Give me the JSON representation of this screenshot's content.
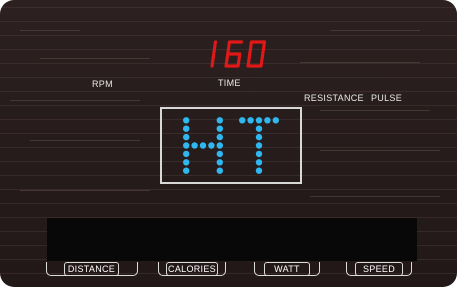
{
  "display": {
    "time_value": "160",
    "matrix_text": "HT",
    "colors": {
      "led_red": "#e01818",
      "led_blue": "#2fb8f0",
      "panel": "#2a1f1f"
    }
  },
  "labels": {
    "rpm": "RPM",
    "time": "TIME",
    "resistance": "RESISTANCE",
    "pulse": "PULSE"
  },
  "buttons": {
    "distance": "DISTANCE",
    "calories": "CALORIES",
    "watt": "WATT",
    "speed": "SPEED"
  }
}
